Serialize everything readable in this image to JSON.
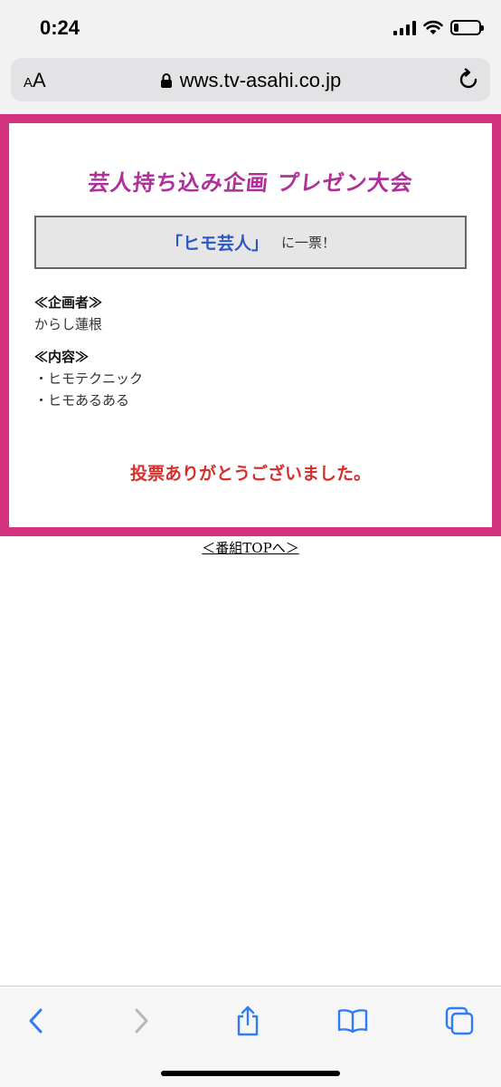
{
  "status_bar": {
    "time": "0:24",
    "icons": [
      "cellular-signal-icon",
      "wifi-icon",
      "battery-icon"
    ],
    "battery_level": 0.2
  },
  "browser": {
    "aa_small": "A",
    "aa_large": "A",
    "url": "wws.tv-asahi.co.jp",
    "icons": [
      "lock-icon",
      "reload-icon"
    ]
  },
  "page": {
    "title": "芸人持ち込み企画 プレゼン大会",
    "vote": {
      "name": "「ヒモ芸人」",
      "suffix": "に一票！"
    },
    "planner": {
      "heading": "≪企画者≫",
      "value": "からし蓮根"
    },
    "contents": {
      "heading": "≪内容≫",
      "items": [
        "・ヒモテクニック",
        "・ヒモあるある"
      ]
    },
    "thanks": "投票ありがとうございました。",
    "top_link": "＜番組TOPへ＞"
  },
  "toolbar": {
    "icons": [
      "back-icon",
      "forward-icon",
      "share-icon",
      "bookmarks-icon",
      "tabs-icon"
    ]
  },
  "colors": {
    "frame": "#d3327f",
    "title": "#b0309a",
    "vote_name": "#2a58c8",
    "thanks": "#d3302c",
    "ios_blue": "#2f7cf6",
    "ios_disabled": "#b8b8bc"
  }
}
